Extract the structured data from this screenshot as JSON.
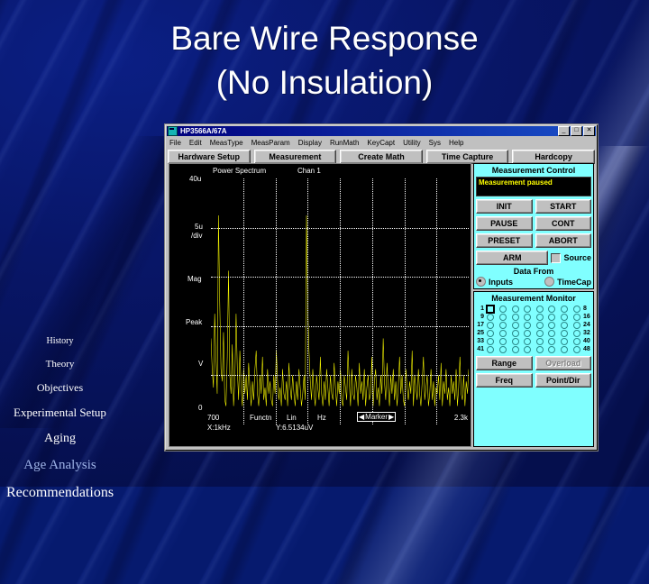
{
  "slide": {
    "title_line1": "Bare Wire Response",
    "title_line2": "(No Insulation)"
  },
  "sidebar": {
    "items": [
      {
        "label": "History",
        "size": 10,
        "active": false
      },
      {
        "label": "Theory",
        "size": 11,
        "active": false
      },
      {
        "label": "Objectives",
        "size": 12,
        "active": false
      },
      {
        "label": "Experimental Setup",
        "size": 13,
        "active": false
      },
      {
        "label": "Aging",
        "size": 14,
        "active": false
      },
      {
        "label": "Age Analysis",
        "size": 15,
        "active": true
      },
      {
        "label": "Recommendations",
        "size": 16,
        "active": false
      }
    ]
  },
  "app": {
    "window_title": "HP3566A/67A",
    "title_buttons": {
      "minimize": "_",
      "maximize": "□",
      "close": "✕"
    },
    "menus": [
      "File",
      "Edit",
      "MeasType",
      "MeasParam",
      "Display",
      "RunMath",
      "KeyCapt",
      "Utility",
      "Sys",
      "Help"
    ],
    "toolbar": [
      "Hardware Setup",
      "Measurement",
      "Create Math",
      "Time Capture",
      "Hardcopy"
    ]
  },
  "plot": {
    "header_left": "Power Spectrum",
    "header_right": "Chan 1",
    "y_top": "40u",
    "y_div": "5u",
    "y_div2": "/div",
    "y_mag": "Mag",
    "y_peak": "Peak",
    "y_unit": "V",
    "y_bottom": "0",
    "x_start": "700",
    "x_funct": "Functn",
    "x_scale": "Lin",
    "x_unit": "Hz",
    "marker_label": "Marker",
    "marker_left": "◀",
    "marker_right": "▶",
    "x_end": "2.3k",
    "readout_x": "X:1kHz",
    "readout_y": "Y:6.5134uV"
  },
  "chart_data": {
    "type": "line",
    "title": "Power Spectrum  Chan 1",
    "xlabel": "Hz",
    "ylabel": "Mag Peak V",
    "xlim": [
      700,
      2300
    ],
    "ylim": [
      0,
      40
    ],
    "y_unit": "uV",
    "y_per_div": 5,
    "x_scale": "Lin",
    "grid": true,
    "marker": {
      "x": "1kHz",
      "y": "6.5134uV"
    },
    "values": [
      14,
      9,
      6,
      18,
      11,
      5,
      34,
      20,
      9,
      7,
      15,
      4,
      3,
      11,
      25,
      8,
      5,
      13,
      3,
      7,
      18,
      9,
      4,
      12,
      6,
      3,
      9,
      5,
      8,
      4,
      10,
      6,
      3,
      7,
      4,
      9,
      12,
      5,
      3,
      8,
      5,
      11,
      4,
      6,
      3,
      9,
      5,
      7,
      4,
      3,
      8,
      5,
      12,
      7,
      4,
      6,
      3,
      9,
      5,
      4,
      7,
      3,
      10,
      6,
      4,
      8,
      5,
      3,
      7,
      4,
      9,
      6,
      3,
      5,
      8,
      4,
      34,
      19,
      12,
      7,
      4,
      9,
      5,
      3,
      8,
      6,
      4,
      11,
      5,
      3,
      7,
      4,
      9,
      6,
      3,
      8,
      5,
      4,
      10,
      6,
      3,
      7,
      5,
      9,
      4,
      3,
      8,
      6,
      4,
      12,
      7,
      3,
      9,
      5,
      4,
      8,
      6,
      3,
      10,
      5,
      7,
      4,
      9,
      3,
      6,
      8,
      4,
      5,
      11,
      3,
      7,
      9,
      4,
      6,
      3,
      8,
      5,
      14,
      7,
      4,
      10,
      6,
      3,
      8,
      5,
      9,
      4,
      7,
      3,
      6,
      11,
      5,
      8,
      4,
      3,
      9,
      6,
      4,
      7,
      5,
      12,
      3,
      8,
      6,
      4,
      9,
      5,
      3,
      7,
      11,
      4,
      6,
      8,
      3,
      5,
      9,
      4,
      7,
      3,
      6,
      5,
      8,
      4,
      10,
      3,
      7,
      5,
      9,
      4,
      6,
      3,
      8,
      5,
      7,
      4,
      9,
      3,
      6,
      11,
      5,
      4,
      8,
      3,
      7,
      5,
      9
    ]
  },
  "measurement_control": {
    "title": "Measurement Control",
    "status": "Measurement paused",
    "buttons": [
      "INIT",
      "START",
      "PAUSE",
      "CONT",
      "PRESET",
      "ABORT",
      "ARM"
    ],
    "source_label": "Source",
    "source_checked": false,
    "data_from_label": "Data From",
    "data_from_options": [
      "Inputs",
      "TimeCap"
    ],
    "data_from_selected": "Inputs"
  },
  "measurement_monitor": {
    "title": "Measurement Monitor",
    "row_labels_left": [
      "1",
      "9",
      "17",
      "25",
      "33",
      "41"
    ],
    "row_labels_right": [
      "8",
      "16",
      "24",
      "32",
      "40",
      "48"
    ],
    "channels_per_row": 8,
    "selected_channel": 1,
    "buttons": [
      {
        "label": "Range",
        "disabled": false
      },
      {
        "label": "Overload",
        "disabled": true
      },
      {
        "label": "Freq",
        "disabled": false
      },
      {
        "label": "Point/Dir",
        "disabled": false
      }
    ]
  },
  "colors": {
    "slide_background": "#061a6e",
    "title_text": "#ffffff",
    "active_nav": "#9fb4e8",
    "panel_cyan": "#80ffff",
    "trace_yellow": "#ffff00",
    "lcd_text": "#ffff00",
    "window_face": "#c0c0c0"
  }
}
